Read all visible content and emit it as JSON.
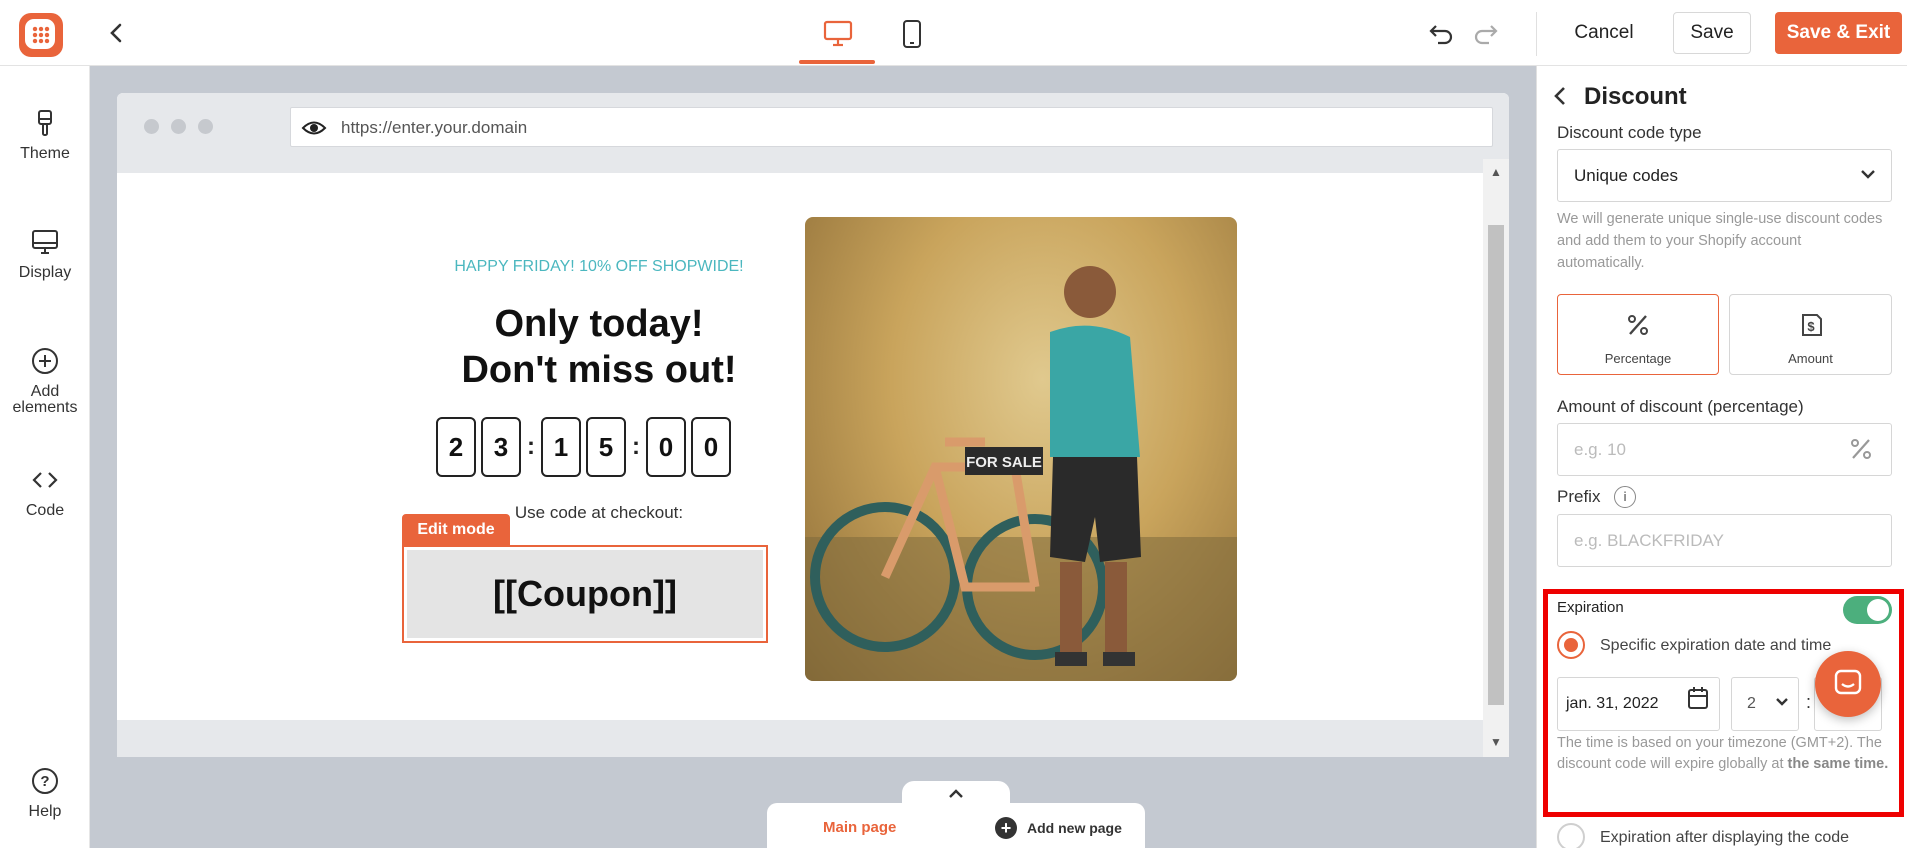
{
  "topbar": {
    "cancel_label": "Cancel",
    "save_label": "Save",
    "save_exit_label": "Save & Exit"
  },
  "sidebar": {
    "items": [
      {
        "label": "Theme",
        "icon": "brush-icon"
      },
      {
        "label": "Display",
        "icon": "monitor-icon"
      },
      {
        "label": "Add elements",
        "icon": "plus-circle-icon"
      },
      {
        "label": "Code",
        "icon": "code-icon"
      }
    ],
    "help_label": "Help"
  },
  "preview": {
    "url": "https://enter.your.domain",
    "kicker": "HAPPY FRIDAY! 10% OFF SHOPWIDE!",
    "headline_line1": "Only today!",
    "headline_line2": "Don't miss out!",
    "countdown": [
      "2",
      "3",
      "1",
      "5",
      "0",
      "0"
    ],
    "use_code": "Use code at checkout:",
    "edit_mode": "Edit mode",
    "coupon": "[[Coupon]]"
  },
  "pages": {
    "main_page": "Main page",
    "add_new_page": "Add new page"
  },
  "panel": {
    "title": "Discount",
    "code_type_label": "Discount code type",
    "code_type_value": "Unique codes",
    "code_type_help": "We will generate unique single-use discount codes and add them to your Shopify account automatically.",
    "types": [
      {
        "label": "Percentage",
        "selected": true
      },
      {
        "label": "Amount",
        "selected": false
      }
    ],
    "amount_label": "Amount of discount (percentage)",
    "amount_placeholder": "e.g. 10",
    "prefix_label": "Prefix",
    "prefix_placeholder": "e.g. BLACKFRIDAY",
    "expiration": {
      "label": "Expiration",
      "enabled": true,
      "option_specific": "Specific expiration date and time",
      "date_value": "jan. 31, 2022",
      "hour_value": "2",
      "tz_note": "The time is based on your timezone (GMT+2). The discount code will expire globally at ",
      "tz_note_bold": "the same time.",
      "option_after_display": "Expiration after displaying the code"
    }
  },
  "colors": {
    "accent": "#e9643b",
    "teal": "#4bb7bf",
    "toggle_on": "#4caf7d",
    "highlight_frame": "#ee0000"
  }
}
